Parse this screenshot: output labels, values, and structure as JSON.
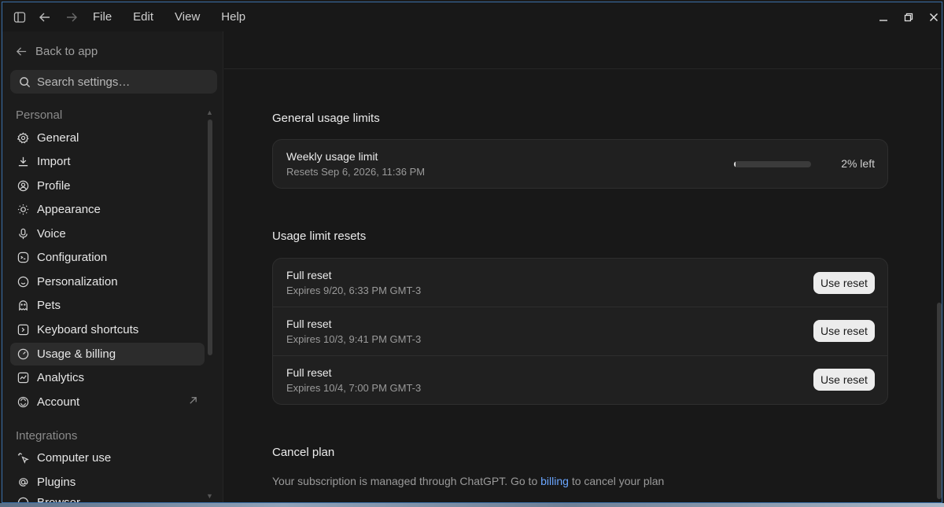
{
  "menu": [
    "File",
    "Edit",
    "View",
    "Help"
  ],
  "sidebar": {
    "back_label": "Back to app",
    "search_placeholder": "Search settings…",
    "sections": {
      "personal": "Personal",
      "integrations": "Integrations"
    },
    "personal_items": [
      {
        "label": "General",
        "icon": "gear-icon"
      },
      {
        "label": "Import",
        "icon": "download-icon"
      },
      {
        "label": "Profile",
        "icon": "profile-icon"
      },
      {
        "label": "Appearance",
        "icon": "sun-icon"
      },
      {
        "label": "Voice",
        "icon": "microphone-icon"
      },
      {
        "label": "Configuration",
        "icon": "configuration-icon"
      },
      {
        "label": "Personalization",
        "icon": "personalization-icon"
      },
      {
        "label": "Pets",
        "icon": "pets-icon"
      },
      {
        "label": "Keyboard shortcuts",
        "icon": "keyboard-icon"
      },
      {
        "label": "Usage & billing",
        "icon": "gauge-icon",
        "active": true
      },
      {
        "label": "Analytics",
        "icon": "analytics-icon"
      },
      {
        "label": "Account",
        "icon": "account-icon",
        "external": true
      }
    ],
    "integration_items": [
      {
        "label": "Computer use",
        "icon": "cursor-sparkle-icon"
      },
      {
        "label": "Plugins",
        "icon": "at-icon"
      },
      {
        "label": "Browser",
        "icon": "browser-icon"
      }
    ]
  },
  "usage": {
    "heading": "General usage limits",
    "weekly_title": "Weekly usage limit",
    "weekly_resets": "Resets Sep 6, 2026, 11:36 PM",
    "remaining_fraction": 0.02,
    "remaining_label": "2% left"
  },
  "resets": {
    "heading": "Usage limit resets",
    "button_label": "Use reset",
    "items": [
      {
        "title": "Full reset",
        "expires": "Expires 9/20, 6:33 PM GMT-3"
      },
      {
        "title": "Full reset",
        "expires": "Expires 10/3, 9:41 PM GMT-3"
      },
      {
        "title": "Full reset",
        "expires": "Expires 10/4, 7:00 PM GMT-3"
      }
    ]
  },
  "cancel": {
    "heading": "Cancel plan",
    "text_before": "Your subscription is managed through ChatGPT. Go to ",
    "link_label": "billing",
    "text_after": " to cancel your plan"
  },
  "colors": {
    "accent_link": "#6aa6ff",
    "background": "#181818",
    "active_item": "#2c2c2c"
  }
}
